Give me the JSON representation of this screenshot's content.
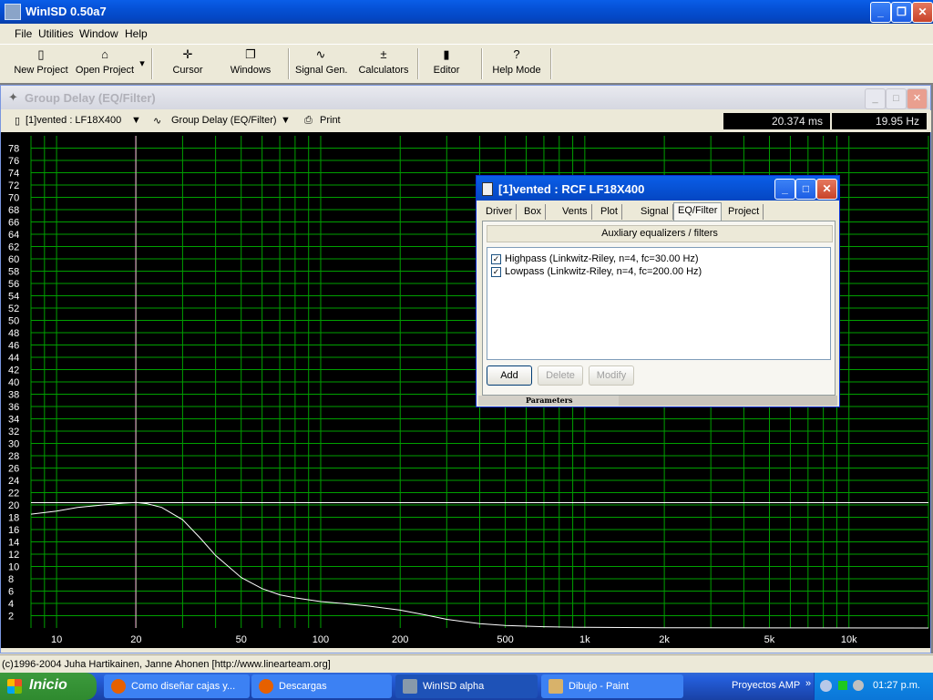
{
  "app": {
    "title": "WinISD 0.50a7"
  },
  "menu": [
    "File",
    "Utilities",
    "Window",
    "Help"
  ],
  "toolbar": [
    {
      "label": "New Project",
      "icon": "new-project-icon"
    },
    {
      "label": "Open Project",
      "icon": "open-project-icon"
    },
    {
      "label": "Cursor",
      "icon": "cursor-icon"
    },
    {
      "label": "Windows",
      "icon": "windows-icon"
    },
    {
      "label": "Signal Gen.",
      "icon": "signal-gen-icon"
    },
    {
      "label": "Calculators",
      "icon": "calculators-icon"
    },
    {
      "label": "Editor",
      "icon": "editor-icon"
    },
    {
      "label": "Help Mode",
      "icon": "help-mode-icon"
    }
  ],
  "child": {
    "title": "Group Delay (EQ/Filter)",
    "project_select": "[1]vented : LF18X400",
    "graph_select": "Group Delay (EQ/Filter)",
    "print_label": "Print",
    "readout_ms": "20.374 ms",
    "readout_hz": "19.95 Hz"
  },
  "chart_data": {
    "type": "line",
    "x_scale": "log",
    "xlim": [
      8,
      20000
    ],
    "ylim": [
      0,
      80
    ],
    "grid": true,
    "x_tick_labels": [
      "10",
      "20",
      "50",
      "100",
      "200",
      "500",
      "1k",
      "2k",
      "5k",
      "10k"
    ],
    "x_tick_values": [
      10,
      20,
      50,
      100,
      200,
      500,
      1000,
      2000,
      5000,
      10000
    ],
    "y_tick_labels": [
      "2",
      "4",
      "6",
      "8",
      "10",
      "12",
      "14",
      "16",
      "18",
      "20",
      "22",
      "24",
      "26",
      "28",
      "30",
      "32",
      "34",
      "36",
      "38",
      "40",
      "42",
      "44",
      "46",
      "48",
      "50",
      "52",
      "54",
      "56",
      "58",
      "60",
      "62",
      "64",
      "66",
      "68",
      "70",
      "72",
      "74",
      "76",
      "78"
    ],
    "cursor": {
      "x": 19.95,
      "y": 20.374
    },
    "series": [
      {
        "x": [
          8,
          10,
          12,
          15,
          18,
          20,
          22,
          25,
          30,
          35,
          40,
          50,
          60,
          70,
          80,
          100,
          120,
          150,
          200,
          250,
          300,
          400,
          500,
          700,
          1000,
          2000,
          5000,
          20000
        ],
        "y": [
          18.5,
          19.0,
          19.6,
          20.0,
          20.3,
          20.4,
          20.2,
          19.6,
          17.6,
          14.6,
          11.8,
          8.2,
          6.4,
          5.4,
          4.9,
          4.3,
          4.0,
          3.6,
          2.9,
          2.1,
          1.4,
          0.7,
          0.4,
          0.2,
          0.1,
          0.05,
          0.02,
          0.0
        ]
      }
    ]
  },
  "dialog": {
    "title": "[1]vented : RCF LF18X400",
    "tabs": [
      "Driver",
      "Box",
      "Vents",
      "Plot",
      "Signal",
      "EQ/Filter",
      "Project"
    ],
    "active_tab": "EQ/Filter",
    "panel_header": "Auxliary equalizers / filters",
    "filters": [
      {
        "label": "Highpass (Linkwitz-Riley, n=4, fc=30.00 Hz)",
        "checked": true
      },
      {
        "label": "Lowpass (Linkwitz-Riley, n=4, fc=200.00 Hz)",
        "checked": true
      }
    ],
    "buttons": {
      "add": "Add",
      "delete": "Delete",
      "modify": "Modify"
    },
    "params_label": "Parameters"
  },
  "status": "(c)1996-2004 Juha Hartikainen, Janne Ahonen [http://www.linearteam.org]",
  "taskbar": {
    "start": "Inicio",
    "tasks": [
      {
        "label": "Como diseñar cajas y...",
        "icon": "firefox-icon"
      },
      {
        "label": "Descargas",
        "icon": "firefox-icon"
      },
      {
        "label": "WinISD alpha",
        "icon": "winisd-icon"
      },
      {
        "label": "Dibujo - Paint",
        "icon": "paint-icon"
      }
    ],
    "toolbar_label": "Proyectos AMP",
    "clock": "01:27 p.m."
  },
  "colors": {
    "plot_bg": "#000000",
    "grid": "#00a000",
    "curve": "#ffffff",
    "cursor_line": "#ff9fe0",
    "hline": "#ffffff"
  }
}
